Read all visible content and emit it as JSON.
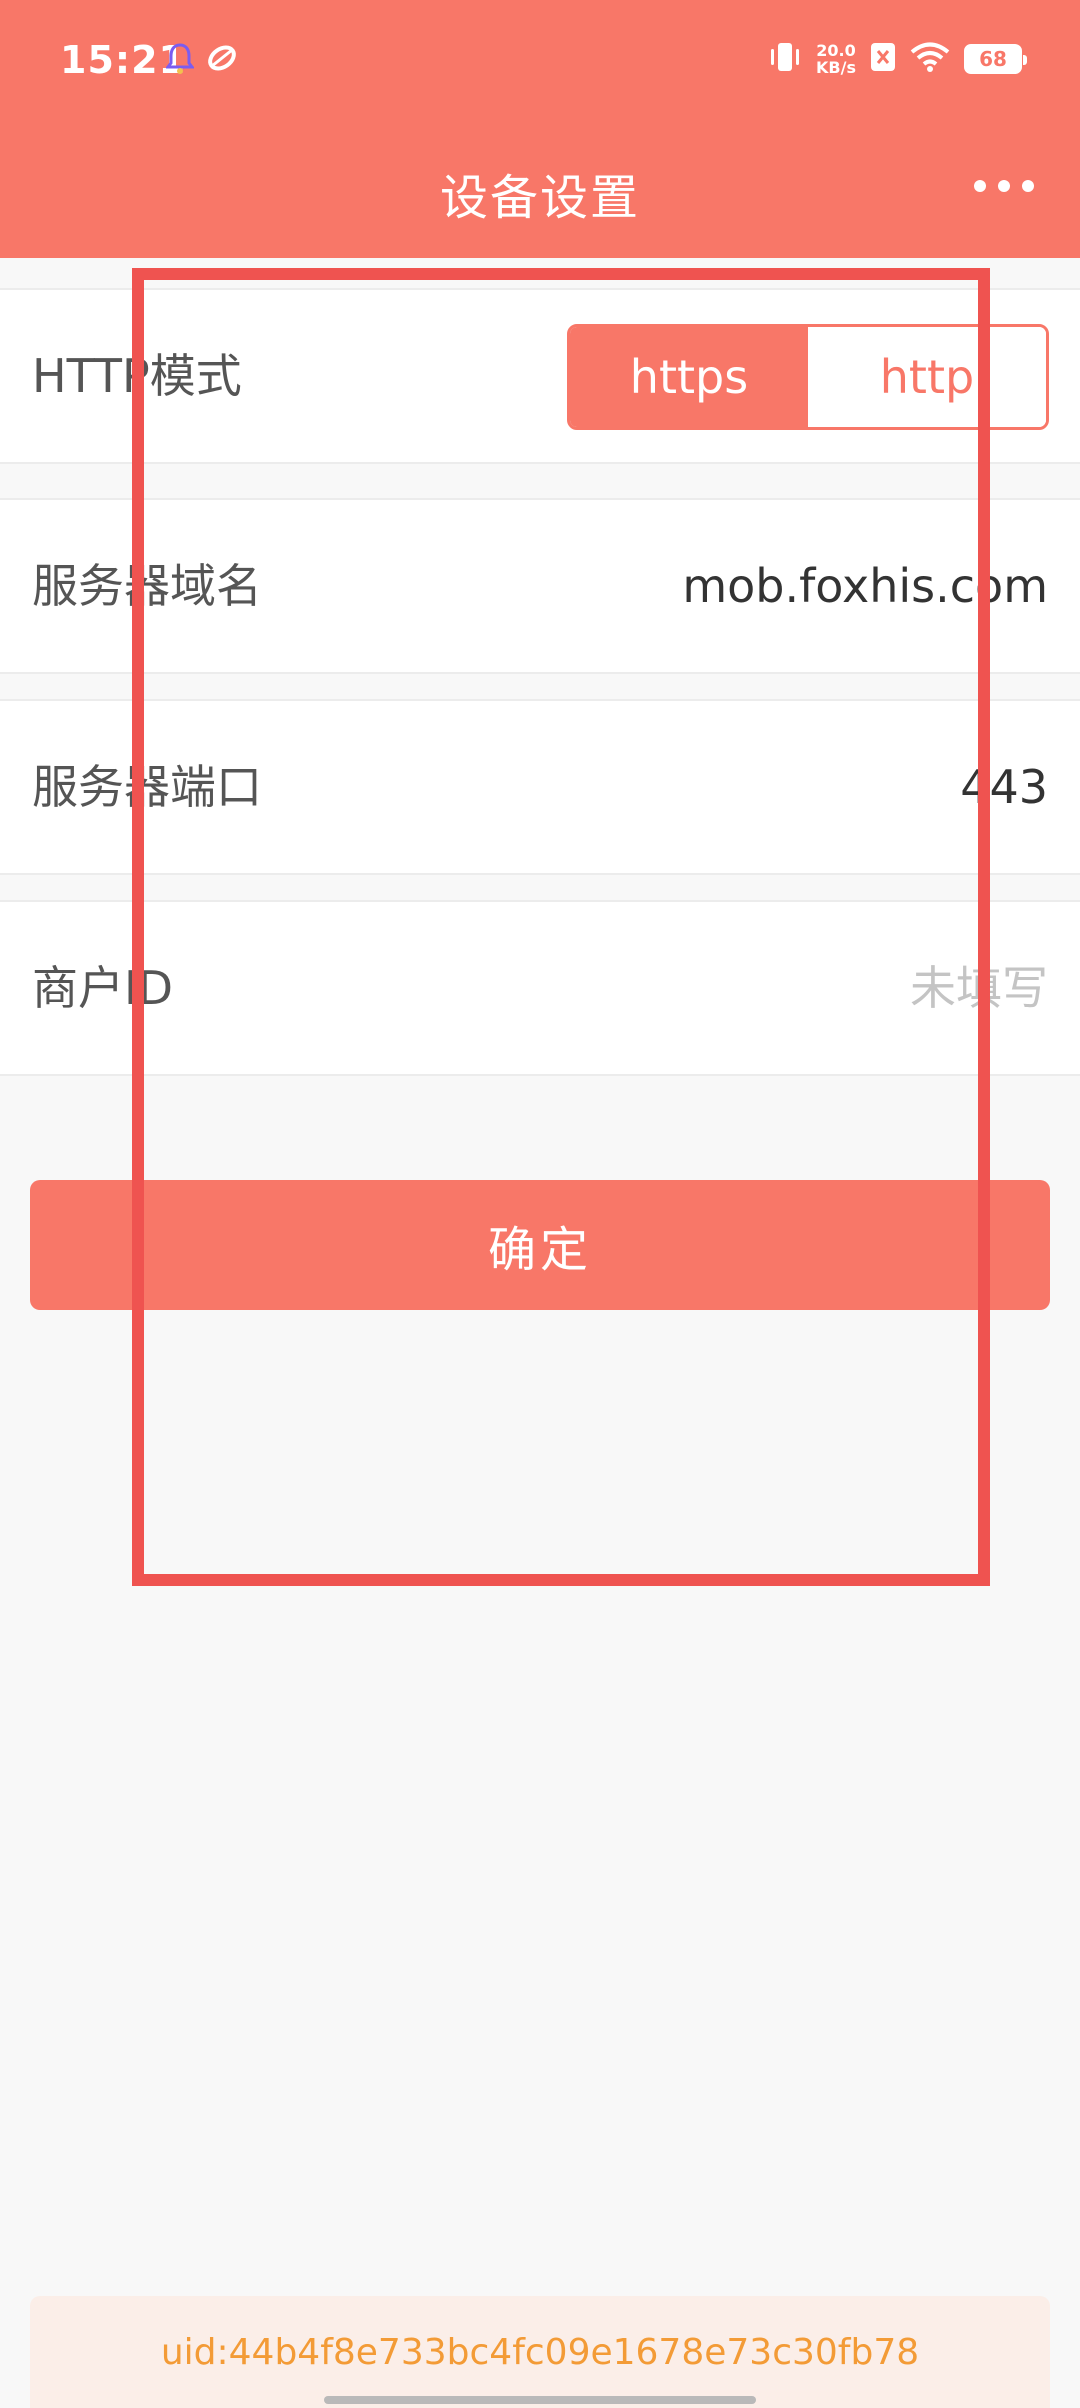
{
  "colors": {
    "accent": "#f87768",
    "highlight": "#ef5350",
    "uid_text": "#f39b36",
    "uid_bg": "#fbeee8",
    "background": "#f8f8f8"
  },
  "status_bar": {
    "time": "15:21",
    "net_speed_value": "20.0",
    "net_speed_unit": "KB/s",
    "battery": "68",
    "icons": [
      "notification-bell-icon",
      "app-logo-icon",
      "vibrate-icon",
      "net-speed",
      "sim-disabled-icon",
      "wifi-icon",
      "battery-icon"
    ]
  },
  "header": {
    "title": "设备设置",
    "more_icon": "more-dots-icon"
  },
  "http_mode": {
    "label": "HTTP模式",
    "options": [
      "https",
      "http"
    ],
    "selected": "https"
  },
  "server_domain": {
    "label": "服务器域名",
    "value": "mob.foxhis.com"
  },
  "server_port": {
    "label": "服务器端口",
    "value": "443"
  },
  "merchant_id": {
    "label": "商户ID",
    "placeholder": "未填写"
  },
  "confirm_button": {
    "label": "确定"
  },
  "uid": {
    "text": "uid:44b4f8e733bc4fc09e1678e73c30fb78"
  }
}
